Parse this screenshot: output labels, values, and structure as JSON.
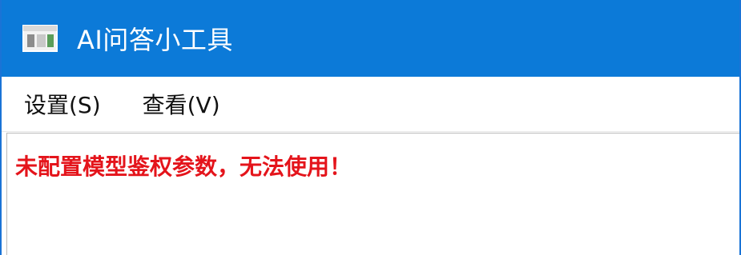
{
  "window": {
    "title": "AI问答小工具",
    "icon": "app-window-icon"
  },
  "menu": {
    "items": [
      {
        "label": "设置(S)"
      },
      {
        "label": "查看(V)"
      }
    ]
  },
  "content": {
    "error_message": "未配置模型鉴权参数，无法使用！"
  },
  "colors": {
    "titlebar": "#0c7ad8",
    "error_text": "#e4141b"
  }
}
